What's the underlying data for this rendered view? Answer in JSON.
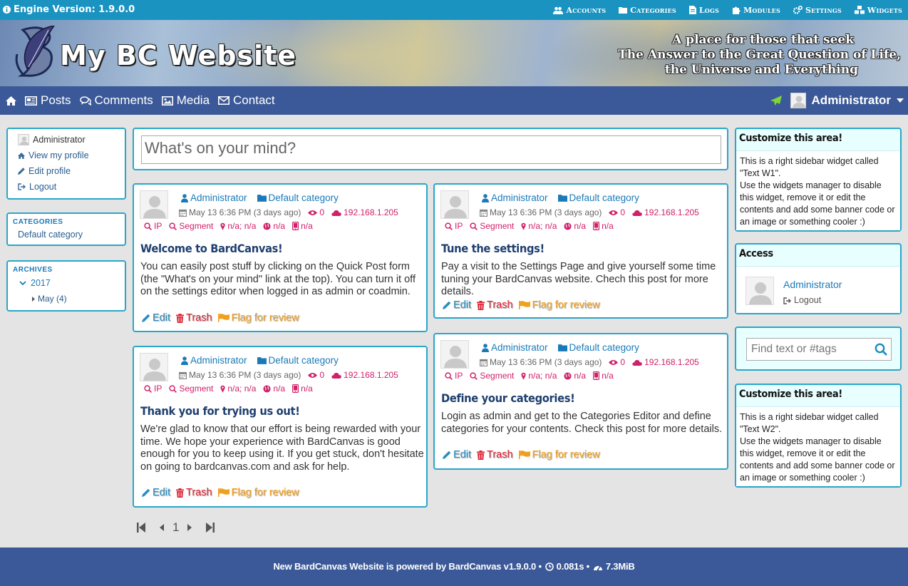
{
  "adminbar": {
    "version_text": "Engine Version: 1.9.0.0",
    "menu": [
      {
        "label": "Accounts",
        "icon": "users-icon"
      },
      {
        "label": "Categories",
        "icon": "folder-icon"
      },
      {
        "label": "Logs",
        "icon": "file-icon"
      },
      {
        "label": "Modules",
        "icon": "puzzle-icon"
      },
      {
        "label": "Settings",
        "icon": "gears-icon"
      },
      {
        "label": "Widgets",
        "icon": "cubes-icon"
      }
    ]
  },
  "header": {
    "site_title": "My BC Website",
    "slogan": [
      "A place for those that seek",
      "The Answer to the Great Question of Life,",
      "the Universe and Everything"
    ]
  },
  "mainnav": {
    "items": [
      {
        "label": "Posts",
        "icon": "newspaper-icon"
      },
      {
        "label": "Comments",
        "icon": "comments-icon"
      },
      {
        "label": "Media",
        "icon": "image-icon"
      },
      {
        "label": "Contact",
        "icon": "envelope-icon"
      }
    ],
    "user_label": "Administrator"
  },
  "left_sidebar": {
    "user_name": "Administrator",
    "links": [
      "View my profile",
      "Edit profile",
      "Logout"
    ],
    "categories_title": "CATEGORIES",
    "categories": [
      "Default category"
    ],
    "archives_title": "ARCHIVES",
    "archive_year": "2017",
    "archive_month": "May (4)"
  },
  "quickpost": {
    "placeholder": "What's on your mind?"
  },
  "posts": [
    {
      "author": "Administrator",
      "category": "Default category",
      "date": "May 13 6:36 PM (3 days ago)",
      "comments": "0",
      "ip": "192.168.1.205",
      "ip_label": "IP",
      "segment_label": "Segment",
      "location": "n/a; n/a",
      "globe": "n/a",
      "device": "n/a",
      "title": "Welcome to BardCanvas!",
      "body": "You can easily post stuff by clicking on the Quick Post form (the \"What's on your mind\" link at the top). You can turn it off on the settings editor when logged in as admin or coadmin."
    },
    {
      "author": "Administrator",
      "category": "Default category",
      "date": "May 13 6:36 PM (3 days ago)",
      "comments": "0",
      "ip": "192.168.1.205",
      "ip_label": "IP",
      "segment_label": "Segment",
      "location": "n/a; n/a",
      "globe": "n/a",
      "device": "n/a",
      "title": "Tune the settings!",
      "body": "Pay a visit to the Settings Page and give yourself some time tuning your BardCanvas website. Chech this post for more details."
    },
    {
      "author": "Administrator",
      "category": "Default category",
      "date": "May 13 6:36 PM (3 days ago)",
      "comments": "0",
      "ip": "192.168.1.205",
      "ip_label": "IP",
      "segment_label": "Segment",
      "location": "n/a; n/a",
      "globe": "n/a",
      "device": "n/a",
      "title": "Thank you for trying us out!",
      "body": "We're glad to know that our effort is being rewarded with your time. We hope your experience with BardCanvas is good enough for you to keep using it. If you get stuck, don't hesitate on going to bardcanvas.com and ask for help."
    },
    {
      "author": "Administrator",
      "category": "Default category",
      "date": "May 13 6:36 PM (3 days ago)",
      "comments": "0",
      "ip": "192.168.1.205",
      "ip_label": "IP",
      "segment_label": "Segment",
      "location": "n/a; n/a",
      "globe": "n/a",
      "device": "n/a",
      "title": "Define your categories!",
      "body": "Login as admin and get to the Categories Editor and define categories for your contents. Check this post for more details."
    }
  ],
  "post_actions": {
    "edit": "Edit",
    "trash": "Trash",
    "flag": "Flag for review"
  },
  "pager": {
    "page": "1"
  },
  "right_sidebar": {
    "text1_title": "Customize this area!",
    "text1_body": "This is a right sidebar widget called \"Text W1\".\nUse the widgets manager to disable this widget, remove it or edit the contents and add some banner code or an image or something cooler :)",
    "access_title": "Access",
    "access_user": "Administrator",
    "access_logout": "Logout",
    "search_placeholder": "Find text or #tags",
    "text2_title": "Customize this area!",
    "text2_body": "This is a right sidebar widget called \"Text W2\".\nUse the widgets manager to disable this widget, remove it or edit the contents and add some banner code or an image or something cooler :)"
  },
  "footer": {
    "text": "New BardCanvas Website is powered by BardCanvas v1.9.0.0 •",
    "time": "0.081s •",
    "memory": "7.3MiB"
  },
  "colors": {
    "topbar": "#1a93c1",
    "nav": "#3b5998",
    "panel_border": "#2aa6c8",
    "link": "#1a7ab8",
    "pink": "#d0206a"
  }
}
